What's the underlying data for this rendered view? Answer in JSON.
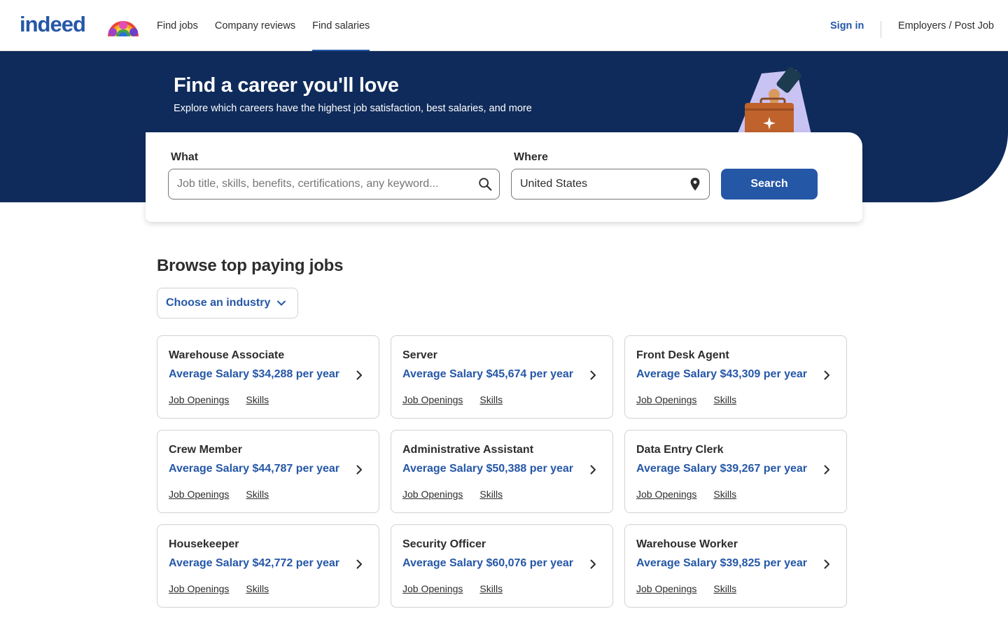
{
  "header": {
    "logo_text": "indeed",
    "nav": [
      {
        "label": "Find jobs",
        "active": false
      },
      {
        "label": "Company reviews",
        "active": false
      },
      {
        "label": "Find salaries",
        "active": true
      }
    ],
    "sign_in": "Sign in",
    "employers": "Employers / Post Job"
  },
  "hero": {
    "title": "Find a career you'll love",
    "subtitle": "Explore which careers have the highest job satisfaction, best salaries, and more"
  },
  "search": {
    "what_label": "What",
    "what_placeholder": "Job title, skills, benefits, certifications, any keyword...",
    "where_label": "Where",
    "where_value": "United States",
    "button": "Search"
  },
  "browse": {
    "title": "Browse top paying jobs",
    "industry_dropdown": "Choose an industry",
    "cards": [
      {
        "title": "Warehouse Associate",
        "salary": "Average Salary $34,288 per year",
        "link1": "Job Openings",
        "link2": "Skills"
      },
      {
        "title": "Server",
        "salary": "Average Salary $45,674 per year",
        "link1": "Job Openings",
        "link2": "Skills"
      },
      {
        "title": "Front Desk Agent",
        "salary": "Average Salary $43,309 per year",
        "link1": "Job Openings",
        "link2": "Skills"
      },
      {
        "title": "Crew Member",
        "salary": "Average Salary $44,787 per year",
        "link1": "Job Openings",
        "link2": "Skills"
      },
      {
        "title": "Administrative Assistant",
        "salary": "Average Salary $50,388 per year",
        "link1": "Job Openings",
        "link2": "Skills"
      },
      {
        "title": "Data Entry Clerk",
        "salary": "Average Salary $39,267 per year",
        "link1": "Job Openings",
        "link2": "Skills"
      },
      {
        "title": "Housekeeper",
        "salary": "Average Salary $42,772 per year",
        "link1": "Job Openings",
        "link2": "Skills"
      },
      {
        "title": "Security Officer",
        "salary": "Average Salary $60,076 per year",
        "link1": "Job Openings",
        "link2": "Skills"
      },
      {
        "title": "Warehouse Worker",
        "salary": "Average Salary $39,825 per year",
        "link1": "Job Openings",
        "link2": "Skills"
      }
    ]
  },
  "colors": {
    "brand_blue": "#2557a7",
    "hero_navy": "#0f2b5b",
    "text": "#2d2d2d",
    "border": "#d4d2d0"
  },
  "icons": [
    "search-icon",
    "location-pin-icon",
    "chevron-down-icon",
    "chevron-right-icon",
    "pride-logo-icon",
    "briefcase-illustration"
  ]
}
